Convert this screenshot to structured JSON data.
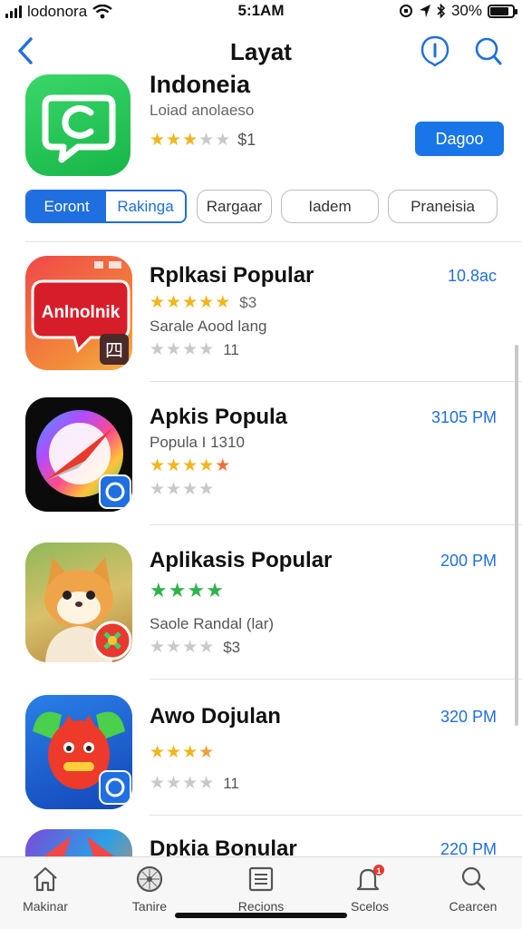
{
  "status": {
    "carrier": "lodonora",
    "time": "5:1AM",
    "battery_text": "30%",
    "battery_level": 0.85
  },
  "nav": {
    "title": "Layat"
  },
  "featured": {
    "title": "Indoneia",
    "subtitle": "Loiad anolaeso",
    "rating_stars": 3,
    "rating_count": "$1",
    "button_label": "Dagoo"
  },
  "tabs": {
    "segment": [
      "Eoront",
      "Rakinga"
    ],
    "chips": [
      "Rargaar",
      "Iadem",
      "Praneisia"
    ]
  },
  "apps": [
    {
      "title": "Rplkasi Popular",
      "time": "10.8ac",
      "line1_stars": 5,
      "line1_text": "$3",
      "line2_text": "Sarale Aood lang",
      "line3_text": "11",
      "icon_label": "Anlnolnik",
      "icon_corner": "四"
    },
    {
      "title": "Apkis Popula",
      "time": "3105 PM",
      "line1_text": "Popula I 1310",
      "line2_stars": 4.5,
      "icon": "compass"
    },
    {
      "title": "Aplikasis Popular",
      "time": "200 PM",
      "line1_stars": 4,
      "line2_text": "Saole Randal (lar)",
      "line3_text": "$3",
      "icon": "cat"
    },
    {
      "title": "Awo Dojulan",
      "time": "320 PM",
      "line1_stars": 3.5,
      "line2_text": "11",
      "icon": "monster"
    },
    {
      "title": "Dpkia Bonular",
      "time": "220 PM"
    }
  ],
  "tabbar": [
    {
      "label": "Makinar",
      "icon": "home-icon"
    },
    {
      "label": "Tanire",
      "icon": "compass-icon"
    },
    {
      "label": "Recions",
      "icon": "list-icon"
    },
    {
      "label": "Scelos",
      "icon": "bell-icon",
      "badge": "1"
    },
    {
      "label": "Cearcen",
      "icon": "search-icon"
    }
  ],
  "colors": {
    "accent": "#1f6fe0",
    "button": "#1976e8",
    "star": "#f2b51d",
    "star_green": "#2db34a"
  }
}
